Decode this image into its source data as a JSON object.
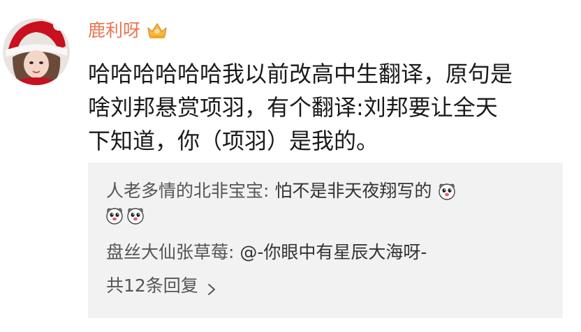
{
  "post": {
    "author_name": "鹿利呀",
    "vip_badge_icon": "vip-crown-icon",
    "content_lines": [
      "哈哈哈哈哈哈我以前改高中生翻译，原句是",
      "啥刘邦悬赏项羽，有个翻译:刘邦要让全天",
      "下知道，你（项羽）是我的。"
    ]
  },
  "replies": [
    {
      "author": "人老多情的北非宝宝:",
      "text": " 怕不是非天夜翔写的",
      "emoji_icon": "dog-face-emoji-icon",
      "extra_emoji_count": 2
    },
    {
      "author": "盘丝大仙张草莓:",
      "text": " @-你眼中有星辰大海呀-"
    }
  ],
  "more_replies_label": "共12条回复",
  "colors": {
    "author_name": "#eb7350",
    "content_text": "#1a1a1a",
    "reply_background": "#f2f2f2",
    "reply_author": "#555555"
  }
}
